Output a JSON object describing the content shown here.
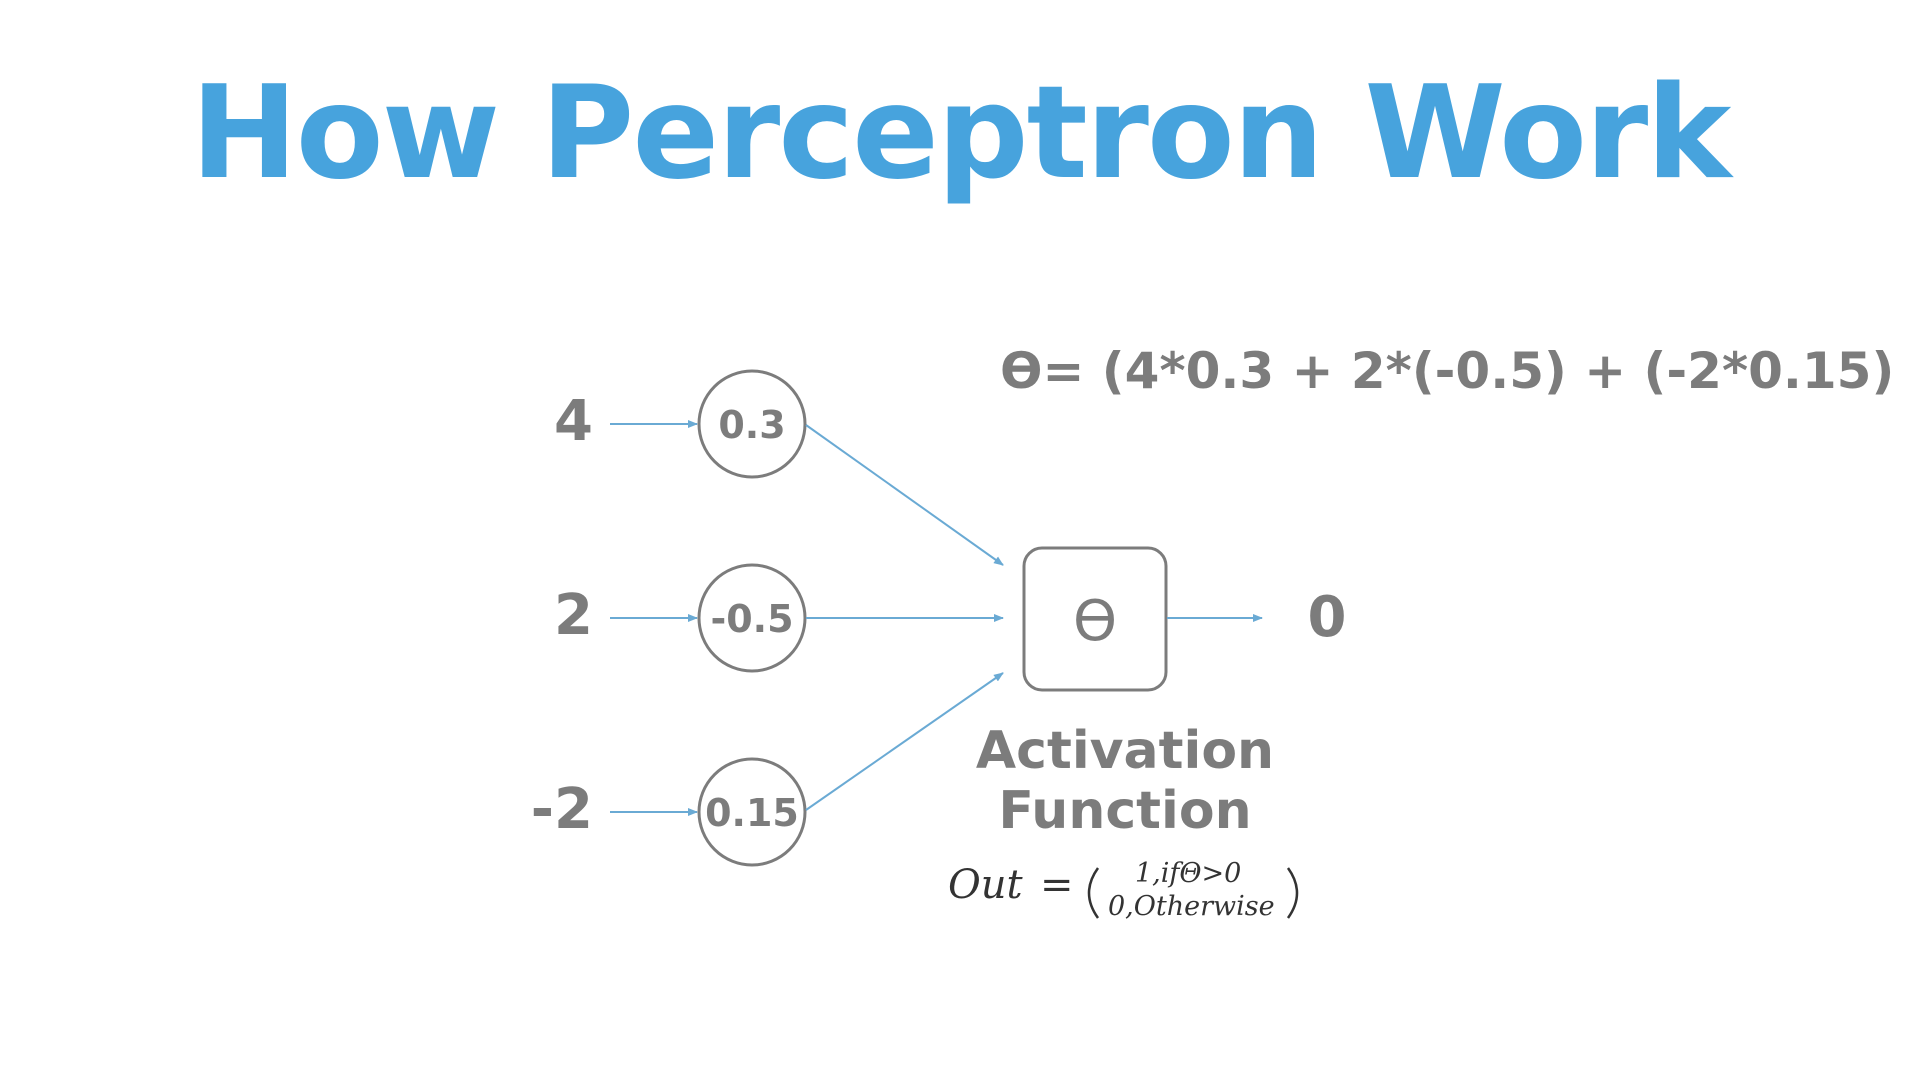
{
  "title": "How Perceptron Work",
  "colors": {
    "title": "#47a3dd",
    "arrow": "#6aaad4",
    "node_stroke": "#7c7c7c",
    "text": "#7c7c7c"
  },
  "formula": "ϴ= (4*0.3 + 2*(-0.5) + (-2*0.15)",
  "inputs": [
    {
      "value": "4",
      "weight": "0.3"
    },
    {
      "value": "2",
      "weight": "-0.5"
    },
    {
      "value": "-2",
      "weight": "0.15"
    }
  ],
  "activation": {
    "symbol": "ϴ",
    "label_line1": "Activation",
    "label_line2": "Function"
  },
  "output": "0",
  "out_rule": {
    "lhs": "Out",
    "equals": "=",
    "case1": "1,ifΘ>0",
    "case2": "0,Otherwise"
  }
}
